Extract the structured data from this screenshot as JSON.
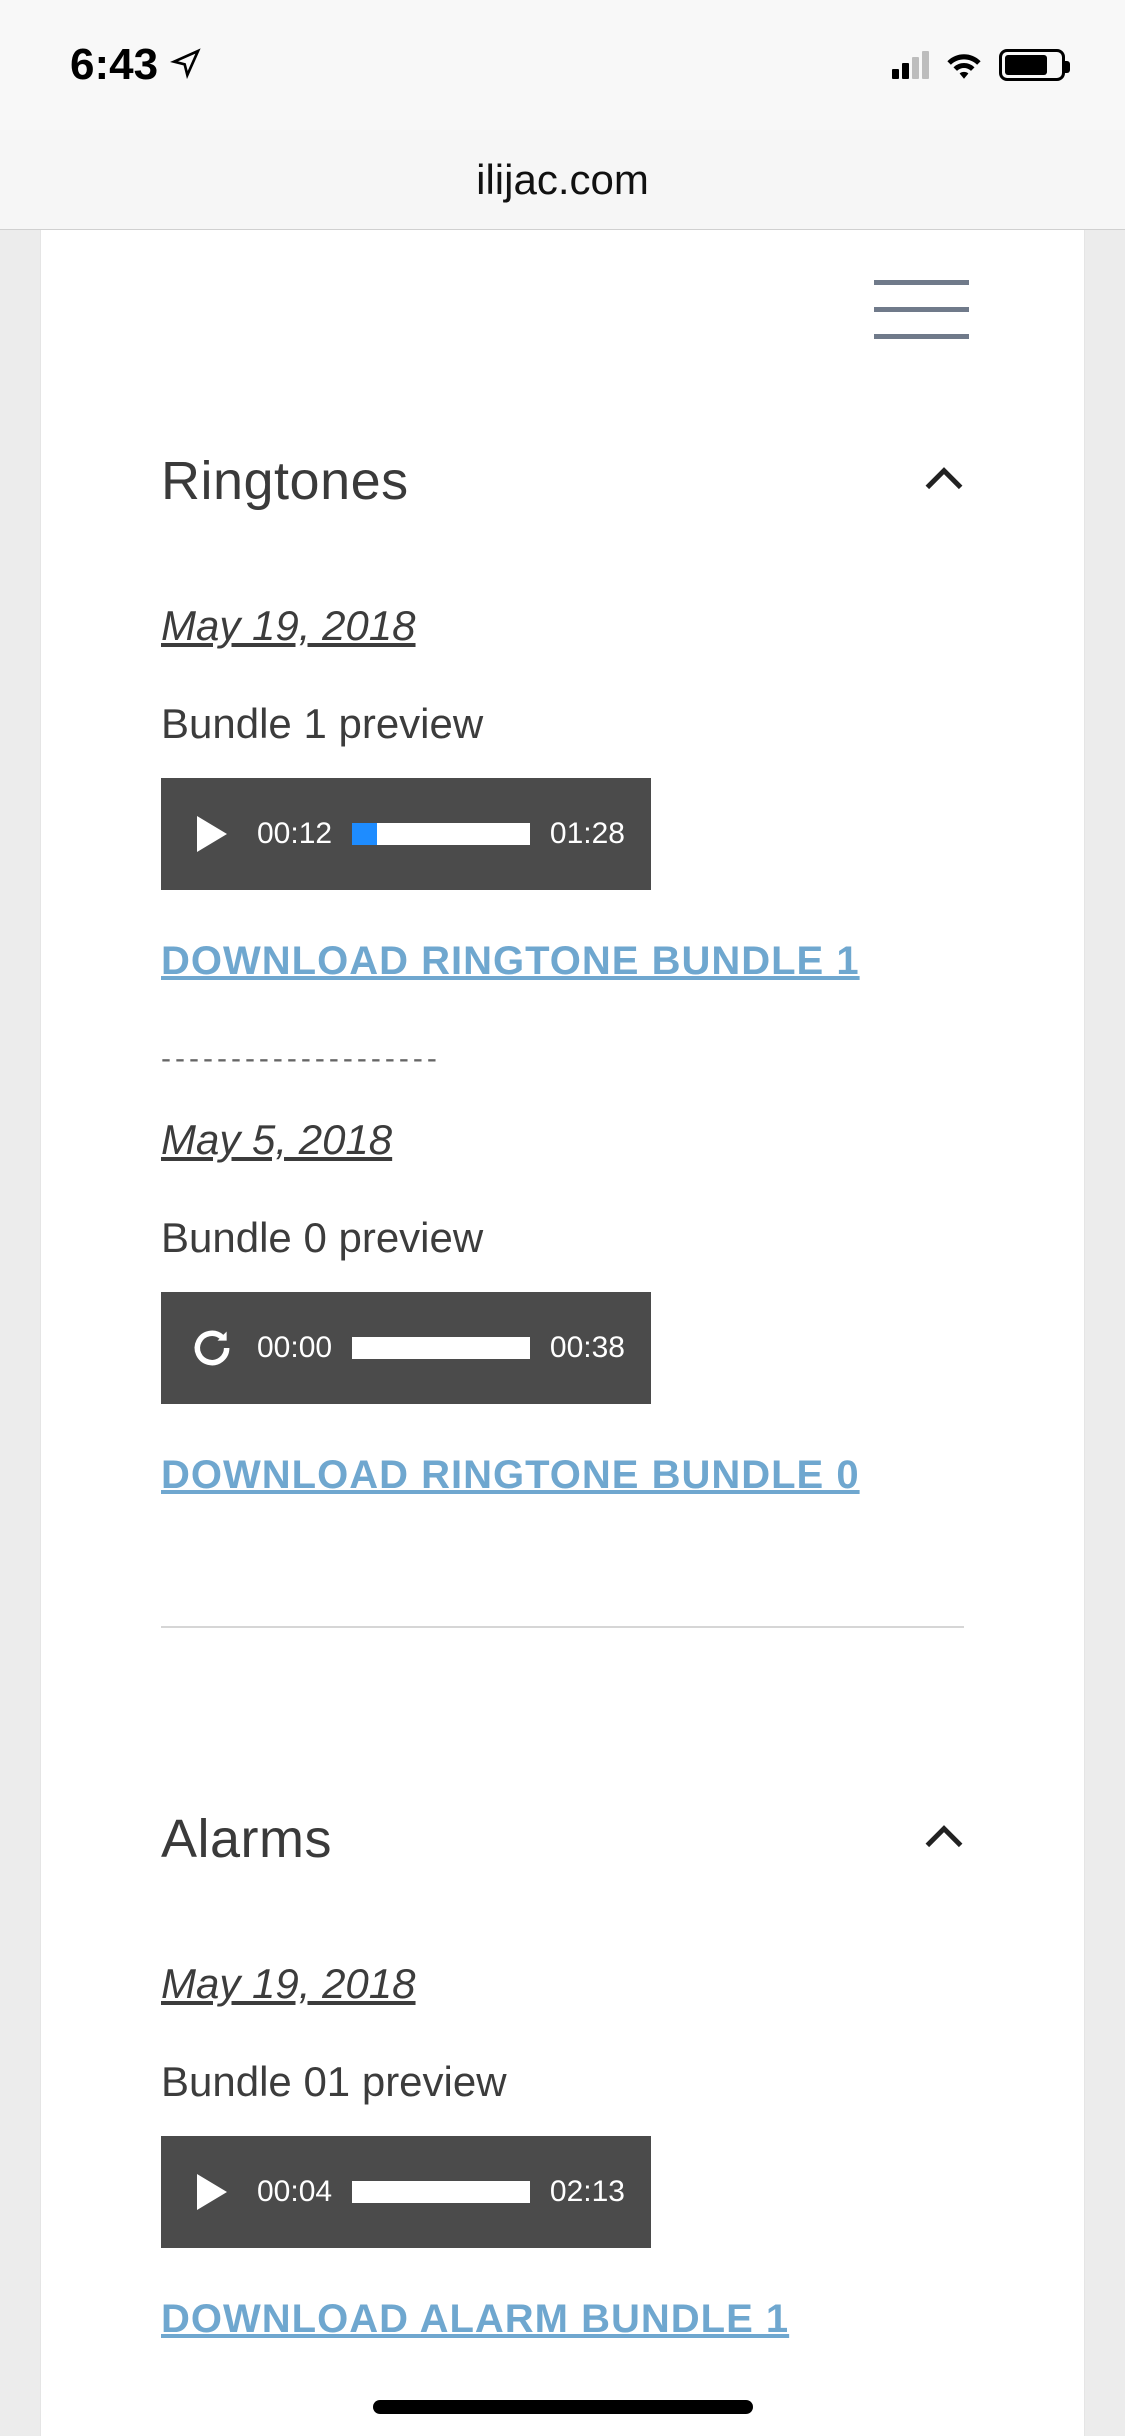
{
  "status": {
    "time": "6:43",
    "signal_active_bars": 2,
    "battery_pct": 78
  },
  "browser": {
    "url": "ilijac.com"
  },
  "sections": {
    "ringtones": {
      "title": "Ringtones",
      "items": [
        {
          "date": "May 19, 2018",
          "label": "Bundle 1 preview",
          "current": "00:12",
          "duration": "01:28",
          "progress_pct": 14,
          "download": "DOWNLOAD RINGTONE BUNDLE 1",
          "state": "play"
        },
        {
          "date": "May 5, 2018",
          "label": "Bundle 0 preview",
          "current": "00:00",
          "duration": "00:38",
          "progress_pct": 0,
          "download": "DOWNLOAD RINGTONE BUNDLE 0",
          "state": "reload"
        }
      ],
      "separator": "--------------------"
    },
    "alarms": {
      "title": "Alarms",
      "items": [
        {
          "date": "May 19, 2018",
          "label": "Bundle 01 preview",
          "current": "00:04",
          "duration": "02:13",
          "progress_pct": 0,
          "download": "DOWNLOAD ALARM BUNDLE 1",
          "state": "play"
        }
      ]
    }
  }
}
